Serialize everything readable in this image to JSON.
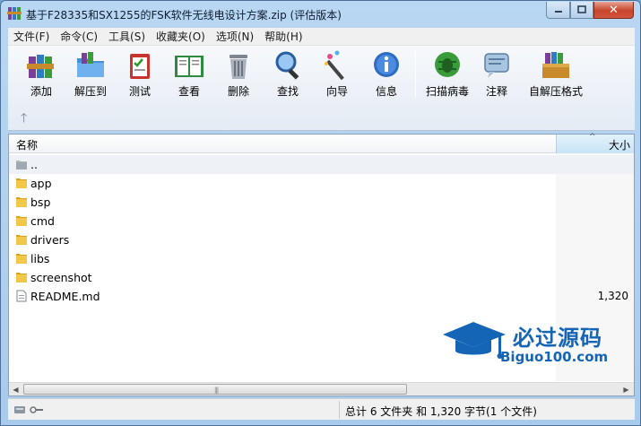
{
  "window": {
    "title": "基于F28335和SX1255的FSK软件无线电设计方案.zip (评估版本)",
    "close_glyph": "✕"
  },
  "menu": [
    "文件(F)",
    "命令(C)",
    "工具(S)",
    "收藏夹(O)",
    "选项(N)",
    "帮助(H)"
  ],
  "toolbar": {
    "buttons": [
      {
        "label": "添加",
        "icon": "add-books-icon"
      },
      {
        "label": "解压到",
        "icon": "extract-folder-icon"
      },
      {
        "label": "测试",
        "icon": "test-clipboard-icon"
      },
      {
        "label": "查看",
        "icon": "view-book-icon"
      },
      {
        "label": "删除",
        "icon": "delete-trash-icon"
      },
      {
        "label": "查找",
        "icon": "find-magnifier-icon"
      },
      {
        "label": "向导",
        "icon": "wizard-wand-icon"
      },
      {
        "label": "信息",
        "icon": "info-icon"
      },
      {
        "label": "扫描病毒",
        "icon": "virus-scan-icon"
      },
      {
        "label": "注释",
        "icon": "comment-icon"
      },
      {
        "label": "自解压格式",
        "icon": "sfx-box-icon"
      }
    ],
    "up_glyph": "🡑"
  },
  "list": {
    "columns": {
      "name": "名称",
      "size": "大小"
    },
    "rows": [
      {
        "name": "..",
        "type": "parent",
        "size": ""
      },
      {
        "name": "app",
        "type": "folder",
        "size": ""
      },
      {
        "name": "bsp",
        "type": "folder",
        "size": ""
      },
      {
        "name": "cmd",
        "type": "folder",
        "size": ""
      },
      {
        "name": "drivers",
        "type": "folder",
        "size": ""
      },
      {
        "name": "libs",
        "type": "folder",
        "size": ""
      },
      {
        "name": "screenshot",
        "type": "folder",
        "size": ""
      },
      {
        "name": "README.md",
        "type": "file",
        "size": "1,320"
      }
    ]
  },
  "watermark": {
    "title": "必过源码",
    "url": "Biguo100.com"
  },
  "status": {
    "summary": "总计 6 文件夹 和 1,320 字节(1 个文件)"
  },
  "colors": {
    "accent": "#1465b5",
    "folder": "#e8b83a",
    "close": "#c7442c"
  }
}
